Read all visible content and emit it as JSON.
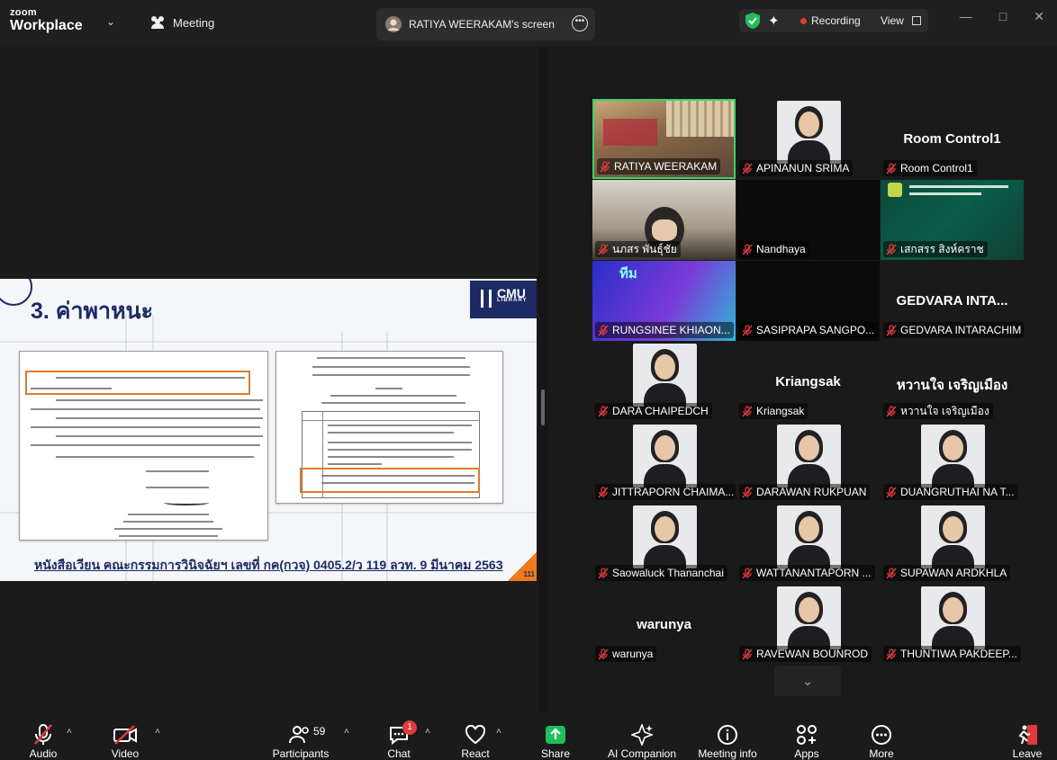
{
  "app": {
    "brand_top": "zoom",
    "brand_bottom": "Workplace"
  },
  "topbar": {
    "meeting_label": "Meeting",
    "screen_tab": "RATIYA WEERAKAM's screen",
    "recording_label": "Recording",
    "view_label": "View"
  },
  "slide": {
    "title": "3. ค่าพาหนะ",
    "logo_text": "CMU",
    "logo_sub": "LIBRARY",
    "footer": "หนังสือเวียน คณะกรรมการวินิจฉัยฯ เลขที่ กค(กวจ) 0405.2/ว 119 ลวท. 9 มีนาคม 2563",
    "page_number": "111"
  },
  "participants": [
    {
      "name": "RATIYA WEERAKAM",
      "kind": "video",
      "active": true
    },
    {
      "name": "APINANUN SRIMA",
      "kind": "photo"
    },
    {
      "name": "Room Control1",
      "kind": "text",
      "big": "Room Control1"
    },
    {
      "name": "นภสร พันธุ์ชัย",
      "kind": "video2"
    },
    {
      "name": "Nandhaya",
      "kind": "dark"
    },
    {
      "name": "เสกสรร สิงห์คราช",
      "kind": "green"
    },
    {
      "name": "RUNGSINEE KHIAON...",
      "kind": "purple"
    },
    {
      "name": "SASIPRAPA SANGPO...",
      "kind": "dark"
    },
    {
      "name": "GEDVARA INTARACHIM",
      "kind": "text",
      "big": "GEDVARA INTA..."
    },
    {
      "name": "DARA CHAIPEDCH",
      "kind": "photo"
    },
    {
      "name": "Kriangsak",
      "kind": "text",
      "big": "Kriangsak"
    },
    {
      "name": "หวานใจ เจริญเมือง",
      "kind": "text",
      "big": "หวานใจ เจริญเมือง"
    },
    {
      "name": "JITTRAPORN CHAIMA...",
      "kind": "photo"
    },
    {
      "name": "DARAWAN RUKPUAN",
      "kind": "photo"
    },
    {
      "name": "DUANGRUTHAI NA T...",
      "kind": "photo"
    },
    {
      "name": "Saowaluck Thananchai",
      "kind": "photo"
    },
    {
      "name": "WATTANANTAPORN ...",
      "kind": "photo"
    },
    {
      "name": "SUPAWAN ARDKHLA",
      "kind": "photo"
    },
    {
      "name": "warunya",
      "kind": "text",
      "big": "warunya"
    },
    {
      "name": "RAVEWAN BOUNROD",
      "kind": "photo"
    },
    {
      "name": "THUNTIWA PAKDEEP...",
      "kind": "photo"
    }
  ],
  "toolbar": {
    "audio": "Audio",
    "video": "Video",
    "participants": "Participants",
    "participants_count": "59",
    "chat": "Chat",
    "chat_badge": "1",
    "react": "React",
    "share": "Share",
    "ai_companion": "AI Companion",
    "meeting_info": "Meeting info",
    "apps": "Apps",
    "more": "More",
    "leave": "Leave"
  },
  "colors": {
    "share_green": "#1fbf5a",
    "recording_red": "#e03a3a",
    "active_border": "#3dd068",
    "slide_navy": "#1d2b64",
    "slide_orange": "#f07a1a"
  }
}
